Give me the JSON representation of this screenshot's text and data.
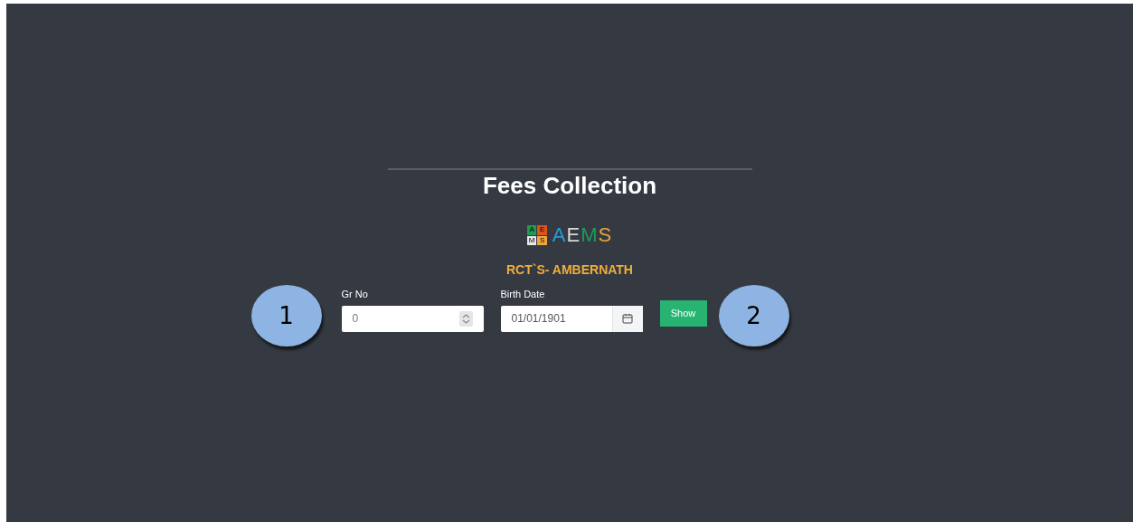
{
  "title": "Fees Collection",
  "logo": {
    "tiles": [
      {
        "letter": "A",
        "color": "#1f9a4e"
      },
      {
        "letter": "E",
        "color": "#d9541e"
      },
      {
        "letter": "M",
        "color": "#e6e6e6"
      },
      {
        "letter": "S",
        "color": "#f0a63a"
      }
    ],
    "wordmark": [
      {
        "letter": "A",
        "color": "#2a9bd8"
      },
      {
        "letter": "E",
        "color": "#d8d8d8"
      },
      {
        "letter": "M",
        "color": "#1f9a5a"
      },
      {
        "letter": "S",
        "color": "#e9a43a"
      }
    ]
  },
  "school": "RCT`S- AMBERNATH",
  "form": {
    "gr_no": {
      "label": "Gr No",
      "value": "0"
    },
    "birth_date": {
      "label": "Birth Date",
      "value": "01/01/1901"
    },
    "button": "Show"
  },
  "callouts": [
    "1",
    "2"
  ]
}
